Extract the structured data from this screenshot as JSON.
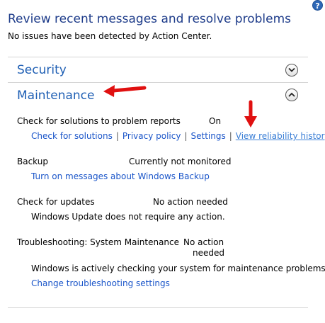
{
  "header": {
    "title": "Review recent messages and resolve problems",
    "subtitle": "No issues have been detected by Action Center.",
    "help_icon": "?"
  },
  "security": {
    "heading": "Security",
    "toggle_icon": "chevron-down-icon"
  },
  "maintenance": {
    "heading": "Maintenance",
    "toggle_icon": "chevron-up-icon",
    "problem_reports": {
      "label": "Check for solutions to problem reports",
      "status": "On",
      "links": {
        "check": "Check for solutions",
        "privacy": "Privacy policy",
        "settings": "Settings",
        "reliability": "View reliability history"
      },
      "separator": "|"
    },
    "backup": {
      "label": "Backup",
      "status": "Currently not monitored",
      "link": "Turn on messages about Windows Backup"
    },
    "updates": {
      "label": "Check for updates",
      "status": "No action needed",
      "description": "Windows Update does not require any action."
    },
    "troubleshooting": {
      "label": "Troubleshooting: System Maintenance",
      "status_line1": "No action",
      "status_line2": "needed",
      "description": "Windows is actively checking your system for maintenance problems.",
      "link": "Change troubleshooting settings"
    }
  },
  "colors": {
    "annotation_arrow": "#e01010",
    "link": "#1a55c9",
    "heading": "#1f5fb4"
  }
}
